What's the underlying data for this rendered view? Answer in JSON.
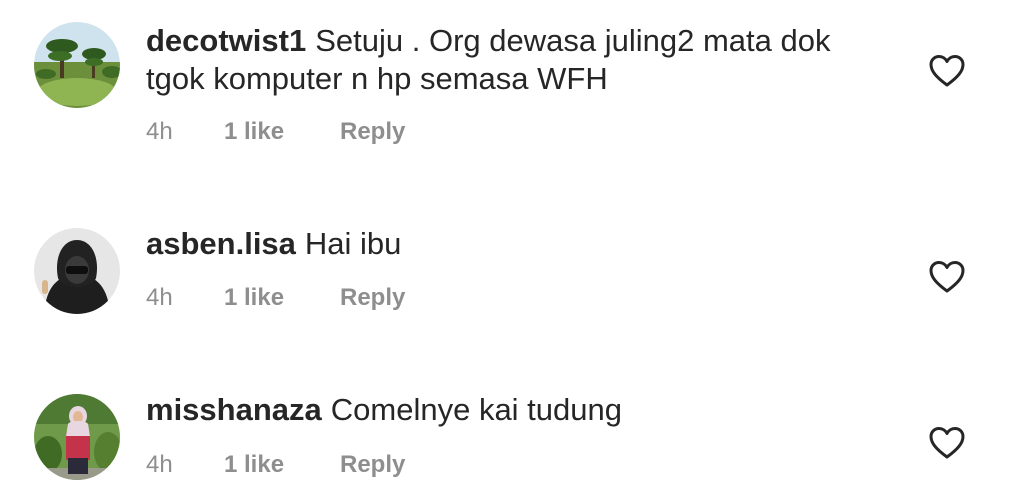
{
  "comments": [
    {
      "username": "decotwist1",
      "text": "Setuju . Org dewasa juling2 mata dok tgok komputer n hp semasa WFH",
      "time": "4h",
      "likes": "1 like",
      "reply_label": "Reply",
      "avatar_icon": "garden-trees-avatar",
      "like_icon": "heart-outline-icon"
    },
    {
      "username": "asben.lisa",
      "text": "Hai ibu",
      "time": "4h",
      "likes": "1 like",
      "reply_label": "Reply",
      "avatar_icon": "hooded-person-avatar",
      "like_icon": "heart-outline-icon"
    },
    {
      "username": "misshanaza",
      "text": "Comelnye kai tudung",
      "time": "4h",
      "likes": "1 like",
      "reply_label": "Reply",
      "avatar_icon": "woman-in-hijab-avatar",
      "like_icon": "heart-outline-icon"
    }
  ],
  "colors": {
    "text": "#262626",
    "secondary": "#8e8e8e",
    "background": "#ffffff"
  }
}
